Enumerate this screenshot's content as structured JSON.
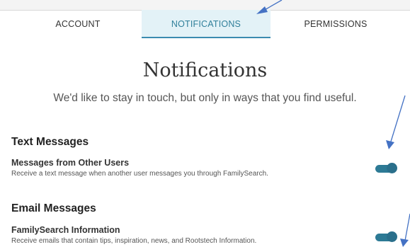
{
  "tabs": [
    {
      "label": "ACCOUNT"
    },
    {
      "label": "NOTIFICATIONS"
    },
    {
      "label": "PERMISSIONS"
    }
  ],
  "active_tab": "NOTIFICATIONS",
  "page": {
    "title": "Notifications",
    "subtitle": "We'd like to stay in touch, but only in ways that you find useful."
  },
  "sections": [
    {
      "title": "Text Messages",
      "items": [
        {
          "title": "Messages from Other Users",
          "description": "Receive a text message when another user messages you through FamilySearch.",
          "enabled": true
        }
      ]
    },
    {
      "title": "Email Messages",
      "items": [
        {
          "title": "FamilySearch Information",
          "description": "Receive emails that contain tips, inspiration, news, and Rootstech Information.",
          "enabled": true
        }
      ]
    }
  ],
  "colors": {
    "accent": "#2d7a95",
    "active_tab_bg": "#e3f2f7",
    "annotation_arrow": "#4472c4"
  }
}
